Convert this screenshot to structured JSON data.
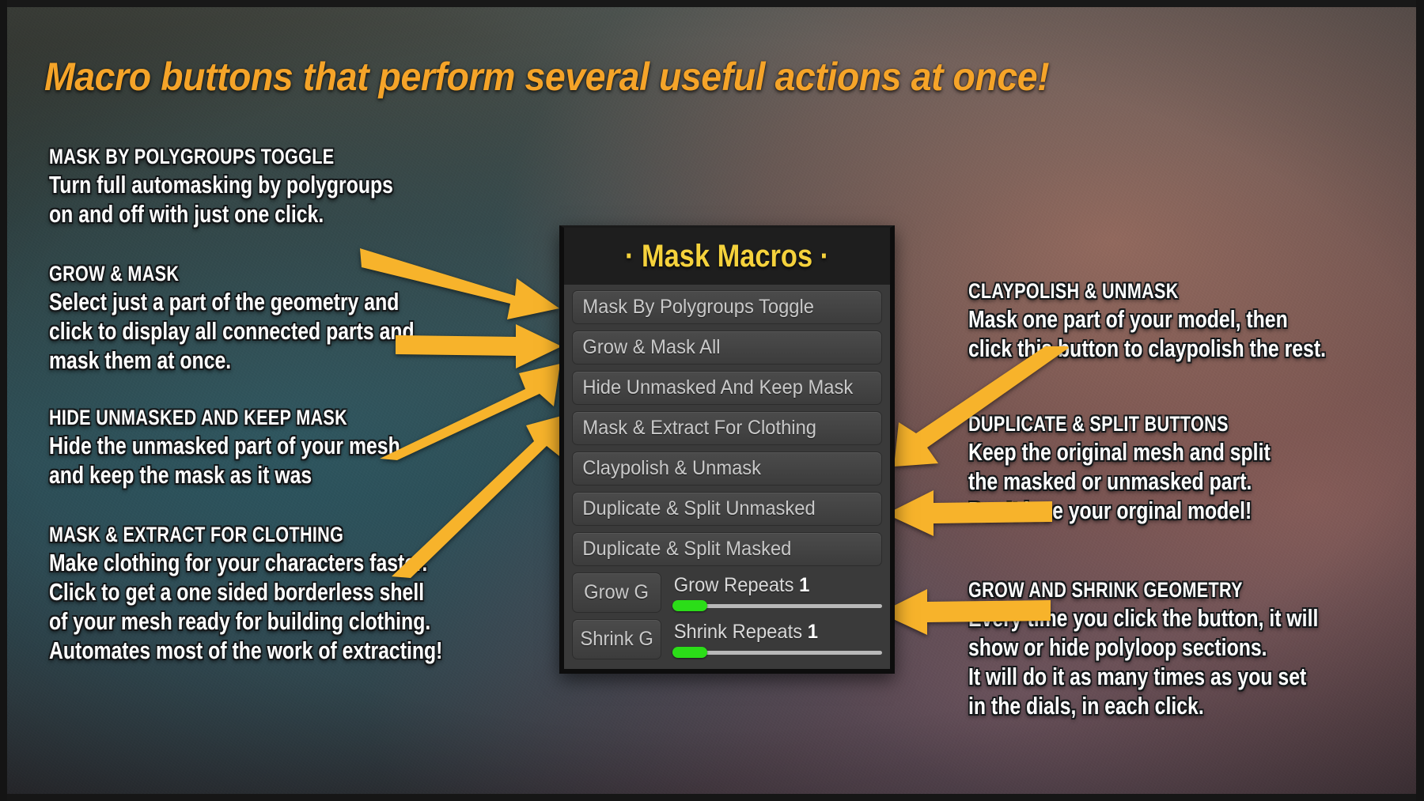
{
  "headline": "Macro buttons that perform several useful actions at once!",
  "colors": {
    "headline": "#F5A429",
    "panel_title": "#F5D23C",
    "arrow": "#F7B32B",
    "slider_knob": "#2BDD18",
    "note_text": "#FFFFFF",
    "panel_bg": "#3A3A3A",
    "button_bg": "#444444"
  },
  "panel": {
    "title": "· Mask Macros ·",
    "buttons": [
      {
        "label": "Mask By Polygroups Toggle"
      },
      {
        "label": "Grow & Mask All"
      },
      {
        "label": "Hide Unmasked And Keep Mask"
      },
      {
        "label": "Mask & Extract For Clothing"
      },
      {
        "label": "Claypolish & Unmask"
      },
      {
        "label": "Duplicate & Split Unmasked"
      },
      {
        "label": "Duplicate & Split Masked"
      }
    ],
    "slider_rows": [
      {
        "button_label": "Grow G",
        "slider_label": "Grow Repeats",
        "value": "1"
      },
      {
        "button_label": "Shrink G",
        "slider_label": "Shrink Repeats",
        "value": "1"
      }
    ]
  },
  "notes_left": [
    {
      "title": "MASK BY POLYGROUPS TOGGLE",
      "lines": [
        "Turn full automasking by polygroups",
        "on and off with just one click."
      ]
    },
    {
      "title": "GROW & MASK",
      "lines": [
        "Select just a part of the geometry and",
        "click to display all connected parts and",
        "mask them at once."
      ]
    },
    {
      "title": "HIDE UNMASKED AND KEEP MASK",
      "lines": [
        "Hide the unmasked part of your mesh",
        "and keep the mask as it was"
      ]
    },
    {
      "title": "MASK & EXTRACT FOR CLOTHING",
      "lines": [
        "Make clothing for your characters faster.",
        "Click to get a one sided borderless shell",
        "of your mesh ready for building clothing.",
        "Automates most of the work of extracting!"
      ]
    }
  ],
  "notes_right": [
    {
      "title": "CLAYPOLISH & UNMASK",
      "lines": [
        "Mask one part of your model, then",
        "click this button to claypolish the rest."
      ]
    },
    {
      "title": "DUPLICATE & SPLIT BUTTONS",
      "lines": [
        "Keep the original mesh and split",
        "the masked or unmasked part.",
        "Don’t lose your orginal model!"
      ]
    },
    {
      "title": "GROW AND SHRINK GEOMETRY",
      "lines": [
        "Every time you click the button, it will",
        "show or hide polyloop sections.",
        "It will do it as many times as you set",
        "in the dials, in each click."
      ]
    }
  ]
}
